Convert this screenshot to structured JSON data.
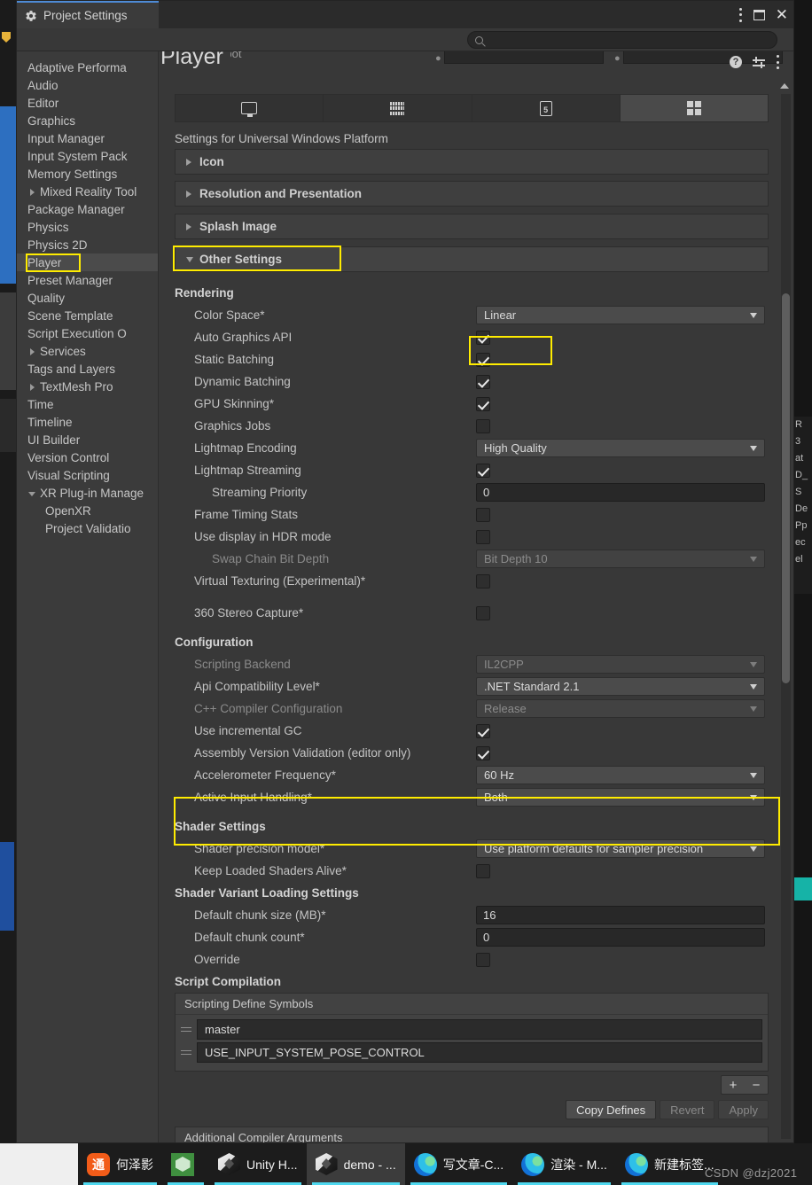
{
  "window": {
    "tab_title": "Project Settings",
    "gear_icon": "gear-icon",
    "controls": {
      "menu": "kebab-menu-icon",
      "maximize": "maximize-icon",
      "close": "close-icon"
    }
  },
  "search": {
    "placeholder": "",
    "value": "",
    "icon": "search-icon"
  },
  "sidebar": {
    "items": [
      {
        "label": "Adaptive Performa",
        "arrow": false,
        "indent": false,
        "selected": false
      },
      {
        "label": "Audio",
        "arrow": false,
        "indent": false,
        "selected": false
      },
      {
        "label": "Editor",
        "arrow": false,
        "indent": false,
        "selected": false
      },
      {
        "label": "Graphics",
        "arrow": false,
        "indent": false,
        "selected": false
      },
      {
        "label": "Input Manager",
        "arrow": false,
        "indent": false,
        "selected": false
      },
      {
        "label": "Input System Pack",
        "arrow": false,
        "indent": false,
        "selected": false
      },
      {
        "label": "Memory Settings",
        "arrow": false,
        "indent": false,
        "selected": false
      },
      {
        "label": "Mixed Reality Tool",
        "arrow": true,
        "indent": false,
        "selected": false
      },
      {
        "label": "Package Manager",
        "arrow": false,
        "indent": false,
        "selected": false
      },
      {
        "label": "Physics",
        "arrow": false,
        "indent": false,
        "selected": false
      },
      {
        "label": "Physics 2D",
        "arrow": false,
        "indent": false,
        "selected": false
      },
      {
        "label": "Player",
        "arrow": false,
        "indent": false,
        "selected": true
      },
      {
        "label": "Preset Manager",
        "arrow": false,
        "indent": false,
        "selected": false
      },
      {
        "label": "Quality",
        "arrow": false,
        "indent": false,
        "selected": false
      },
      {
        "label": "Scene Template",
        "arrow": false,
        "indent": false,
        "selected": false
      },
      {
        "label": "Script Execution O",
        "arrow": false,
        "indent": false,
        "selected": false
      },
      {
        "label": "Services",
        "arrow": true,
        "indent": false,
        "selected": false
      },
      {
        "label": "Tags and Layers",
        "arrow": false,
        "indent": false,
        "selected": false
      },
      {
        "label": "TextMesh Pro",
        "arrow": true,
        "indent": false,
        "selected": false
      },
      {
        "label": "Time",
        "arrow": false,
        "indent": false,
        "selected": false
      },
      {
        "label": "Timeline",
        "arrow": false,
        "indent": false,
        "selected": false
      },
      {
        "label": "UI Builder",
        "arrow": false,
        "indent": false,
        "selected": false
      },
      {
        "label": "Version Control",
        "arrow": false,
        "indent": false,
        "selected": false
      },
      {
        "label": "Visual Scripting",
        "arrow": false,
        "indent": false,
        "selected": false
      },
      {
        "label": "XR Plug-in Manage",
        "arrow": true,
        "expanded": true,
        "indent": false,
        "selected": false
      },
      {
        "label": "OpenXR",
        "arrow": false,
        "indent": true,
        "selected": false
      },
      {
        "label": "Project Validatio",
        "arrow": false,
        "indent": true,
        "selected": false
      }
    ]
  },
  "header": {
    "title": "Player",
    "help_icon": "help-icon",
    "preset_icon": "preset-sliders-icon",
    "menu_icon": "kebab-menu-icon",
    "clipped_label": "Color Hotspot"
  },
  "platform_tabs": [
    {
      "name": "standalone",
      "icon": "monitor-icon",
      "selected": false
    },
    {
      "name": "dedicated-server",
      "icon": "server-icon",
      "selected": false
    },
    {
      "name": "webgl",
      "icon": "html5-icon",
      "label": "5",
      "selected": false
    },
    {
      "name": "uwp",
      "icon": "windows-icon",
      "selected": true
    }
  ],
  "settings_for": "Settings for Universal Windows Platform",
  "foldouts": [
    {
      "label": "Icon",
      "open": false
    },
    {
      "label": "Resolution and Presentation",
      "open": false
    },
    {
      "label": "Splash Image",
      "open": false
    },
    {
      "label": "Other Settings",
      "open": true,
      "highlighted": true
    }
  ],
  "sections": {
    "rendering": {
      "title": "Rendering",
      "rows": [
        {
          "label": "Color Space*",
          "type": "dropdown",
          "value": "Linear",
          "highlighted": true
        },
        {
          "label": "Auto Graphics API",
          "type": "checkbox",
          "checked": true
        },
        {
          "label": "Static Batching",
          "type": "checkbox",
          "checked": true
        },
        {
          "label": "Dynamic Batching",
          "type": "checkbox",
          "checked": true
        },
        {
          "label": "GPU Skinning*",
          "type": "checkbox",
          "checked": true
        },
        {
          "label": "Graphics Jobs",
          "type": "checkbox",
          "checked": false
        },
        {
          "label": "Lightmap Encoding",
          "type": "dropdown",
          "value": "High Quality"
        },
        {
          "label": "Lightmap Streaming",
          "type": "checkbox",
          "checked": true
        },
        {
          "label": "Streaming Priority",
          "type": "text",
          "value": "0",
          "sub": true
        },
        {
          "label": "Frame Timing Stats",
          "type": "checkbox",
          "checked": false
        },
        {
          "label": "Use display in HDR mode",
          "type": "checkbox",
          "checked": false
        },
        {
          "label": "Swap Chain Bit Depth",
          "type": "dropdown",
          "value": "Bit Depth 10",
          "sub": true,
          "disabled": true
        },
        {
          "label": "Virtual Texturing (Experimental)*",
          "type": "checkbox",
          "checked": false
        },
        {
          "label": "",
          "type": "spacer"
        },
        {
          "label": "360 Stereo Capture*",
          "type": "checkbox",
          "checked": false
        }
      ]
    },
    "configuration": {
      "title": "Configuration",
      "rows": [
        {
          "label": "Scripting Backend",
          "type": "dropdown",
          "value": "IL2CPP",
          "disabled": true
        },
        {
          "label": "Api Compatibility Level*",
          "type": "dropdown",
          "value": ".NET Standard 2.1"
        },
        {
          "label": "C++ Compiler Configuration",
          "type": "dropdown",
          "value": "Release",
          "disabled": true
        },
        {
          "label": "Use incremental GC",
          "type": "checkbox",
          "checked": true
        },
        {
          "label": "Assembly Version Validation (editor only)",
          "type": "checkbox",
          "checked": true
        },
        {
          "label": "Accelerometer Frequency*",
          "type": "dropdown",
          "value": "60 Hz",
          "in_highlight": true
        },
        {
          "label": "Active Input Handling*",
          "type": "dropdown",
          "value": "Both",
          "in_highlight": true
        }
      ]
    },
    "shader_settings": {
      "title": "Shader Settings",
      "rows": [
        {
          "label": "Shader precision model*",
          "type": "dropdown",
          "value": "Use platform defaults for sampler precision"
        },
        {
          "label": "Keep Loaded Shaders Alive*",
          "type": "checkbox",
          "checked": false
        }
      ]
    },
    "shader_variant": {
      "title": "Shader Variant Loading Settings",
      "rows": [
        {
          "label": "Default chunk size (MB)*",
          "type": "text",
          "value": "16"
        },
        {
          "label": "Default chunk count*",
          "type": "text",
          "value": "0"
        },
        {
          "label": "Override",
          "type": "checkbox",
          "checked": false
        }
      ]
    },
    "script_compilation": {
      "title": "Script Compilation",
      "define_symbols_header": "Scripting Define Symbols",
      "defines": [
        "master",
        "USE_INPUT_SYSTEM_POSE_CONTROL"
      ],
      "add_label": "+",
      "remove_label": "−",
      "buttons": [
        {
          "label": "Copy Defines",
          "disabled": false
        },
        {
          "label": "Revert",
          "disabled": true
        },
        {
          "label": "Apply",
          "disabled": true
        }
      ],
      "additional_args_header": "Additional Compiler Arguments"
    }
  },
  "highlight_color": "#ffec00",
  "taskbar": {
    "items": [
      {
        "label": "何泽影",
        "icon": "wechat-icon",
        "active": false,
        "running": true
      },
      {
        "label": "",
        "icon": "green-hex-icon",
        "active": false,
        "running": true
      },
      {
        "label": "Unity H...",
        "icon": "unity-icon",
        "active": false,
        "running": true
      },
      {
        "label": "demo - ...",
        "icon": "unity-icon",
        "active": true,
        "running": true
      },
      {
        "label": "写文章-C...",
        "icon": "edge-icon",
        "active": false,
        "running": true
      },
      {
        "label": "渲染 - M...",
        "icon": "edge-icon",
        "active": false,
        "running": true
      },
      {
        "label": "新建标签...",
        "icon": "edge-icon",
        "active": false,
        "running": true
      }
    ],
    "watermark": "CSDN @dzj2021"
  },
  "background_glyphs": [
    "R",
    "3",
    "at",
    "D_",
    "S",
    "De",
    "Pp",
    "ec",
    "el"
  ]
}
